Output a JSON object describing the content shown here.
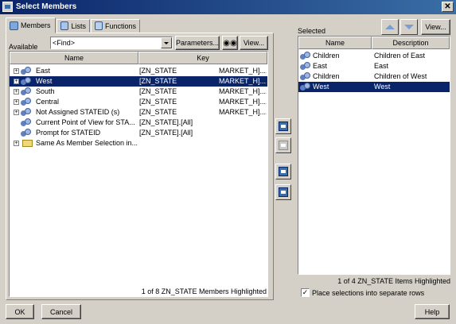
{
  "window": {
    "title": "Select Members",
    "close": "✕"
  },
  "tabs": [
    {
      "label": "Members"
    },
    {
      "label": "Lists"
    },
    {
      "label": "Functions"
    }
  ],
  "available": {
    "label": "Available",
    "find_value": "<Find>",
    "parameters_button": "Parameters...",
    "view_button": "View...",
    "columns": [
      "Name",
      "Key"
    ],
    "rows": [
      {
        "name": "East",
        "key": "[ZN_STATE",
        "key2": "MARKET_H]....",
        "expander": "+"
      },
      {
        "name": "West",
        "key": "[ZN_STATE",
        "key2": "MARKET_H]....",
        "expander": "+"
      },
      {
        "name": "South",
        "key": "[ZN_STATE",
        "key2": "MARKET_H]....",
        "expander": "+"
      },
      {
        "name": "Central",
        "key": "[ZN_STATE",
        "key2": "MARKET_H]....",
        "expander": "+"
      },
      {
        "name": "Not Assigned STATEID (s)",
        "key": "[ZN_STATE",
        "key2": "MARKET_H]....",
        "expander": "+"
      },
      {
        "name": "Current Point of View for STA...",
        "key": "[ZN_STATE].[All]",
        "key2": ""
      },
      {
        "name": "Prompt for STATEID",
        "key": "[ZN_STATE].[All]",
        "key2": ""
      },
      {
        "name": "Same As Member Selection in...",
        "key": "",
        "key2": "",
        "expander": "+"
      }
    ],
    "status": "1 of 8 ZN_STATE Members Highlighted"
  },
  "selected": {
    "label": "Selected",
    "view_button": "View...",
    "columns": [
      "Name",
      "Description"
    ],
    "rows": [
      {
        "name": "Children",
        "description": "Children of East"
      },
      {
        "name": "East",
        "description": "East"
      },
      {
        "name": "Children",
        "description": "Children of West"
      },
      {
        "name": "West",
        "description": "West"
      }
    ],
    "status": "1 of 4 ZN_STATE Items Highlighted",
    "separate_rows_label": "Place selections into separate rows",
    "separate_rows_checked": "✓"
  },
  "footer": {
    "ok": "OK",
    "cancel": "Cancel",
    "help": "Help"
  },
  "colors": {
    "selection": "#0a246a",
    "title_start": "#0a246a",
    "title_end": "#3a6ea5",
    "dialog": "#d4d0c8"
  }
}
